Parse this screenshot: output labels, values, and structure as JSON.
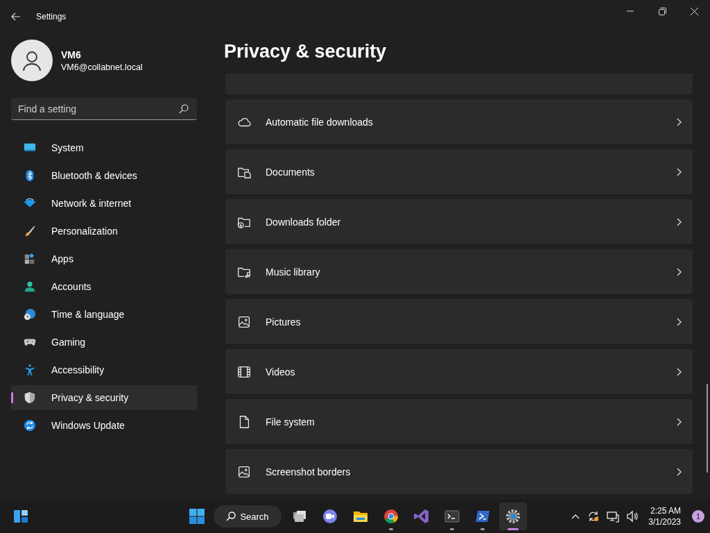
{
  "window": {
    "title": "Settings"
  },
  "account": {
    "name": "VM6",
    "email": "VM6@collabnet.local"
  },
  "search": {
    "placeholder": "Find a setting"
  },
  "nav": [
    {
      "label": "System",
      "selected": false
    },
    {
      "label": "Bluetooth & devices",
      "selected": false
    },
    {
      "label": "Network & internet",
      "selected": false
    },
    {
      "label": "Personalization",
      "selected": false
    },
    {
      "label": "Apps",
      "selected": false
    },
    {
      "label": "Accounts",
      "selected": false
    },
    {
      "label": "Time & language",
      "selected": false
    },
    {
      "label": "Gaming",
      "selected": false
    },
    {
      "label": "Accessibility",
      "selected": false
    },
    {
      "label": "Privacy & security",
      "selected": true
    },
    {
      "label": "Windows Update",
      "selected": false
    }
  ],
  "page_title": "Privacy & security",
  "cards": [
    {
      "label": "Automatic file downloads"
    },
    {
      "label": "Documents"
    },
    {
      "label": "Downloads folder"
    },
    {
      "label": "Music library"
    },
    {
      "label": "Pictures"
    },
    {
      "label": "Videos"
    },
    {
      "label": "File system"
    },
    {
      "label": "Screenshot borders"
    }
  ],
  "taskbar": {
    "search_label": "Search",
    "apps": [
      {
        "running": false,
        "active": false
      },
      {
        "running": false,
        "active": false
      },
      {
        "running": false,
        "active": false
      },
      {
        "running": true,
        "active": false
      },
      {
        "running": false,
        "active": false
      },
      {
        "running": true,
        "active": false
      },
      {
        "running": true,
        "active": false
      },
      {
        "running": true,
        "active": true
      }
    ],
    "clock": {
      "time": "2:25 AM",
      "date": "3/1/2023"
    },
    "notification_count": "1"
  }
}
